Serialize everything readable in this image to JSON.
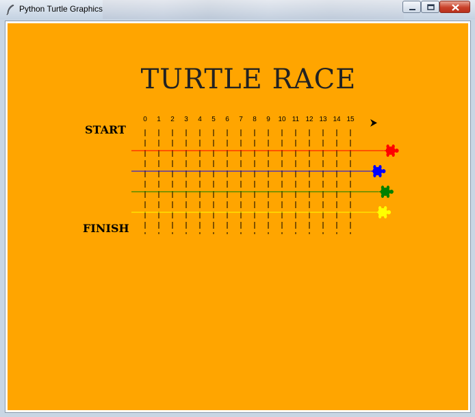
{
  "window": {
    "title": "Python Turtle Graphics",
    "controls": {
      "minimize": "minimize-icon",
      "maximize": "maximize-icon",
      "close": "close-icon"
    }
  },
  "canvas": {
    "background": "#ffa500",
    "heading": "TURTLE RACE",
    "start_label": "START",
    "finish_label": "FINISH",
    "track_numbers": [
      "0",
      "1",
      "2",
      "3",
      "4",
      "5",
      "6",
      "7",
      "8",
      "9",
      "10",
      "11",
      "12",
      "13",
      "14",
      "15"
    ],
    "racers": [
      {
        "color": "#ff0000",
        "progress": 0.96
      },
      {
        "color": "#0000ff",
        "progress": 0.91
      },
      {
        "color": "#008000",
        "progress": 0.94
      },
      {
        "color": "#ffff00",
        "progress": 0.93
      }
    ],
    "start_marker": "arrow-cursor-icon"
  }
}
